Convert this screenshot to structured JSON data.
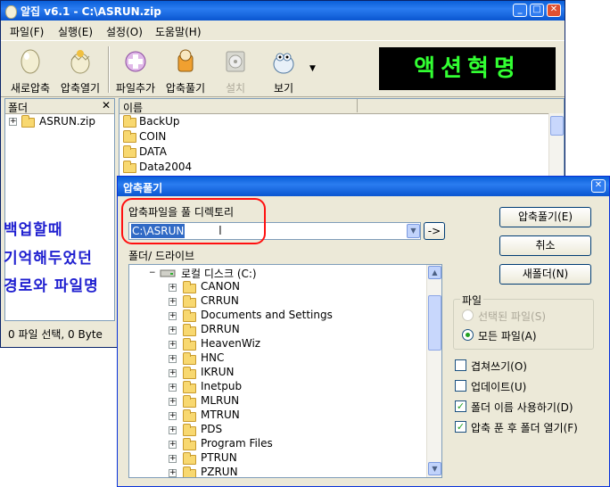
{
  "main_window": {
    "title": "알집 v6.1 - C:\\ASRUN.zip",
    "menus": [
      "파일(F)",
      "실행(E)",
      "설정(O)",
      "도움말(H)"
    ],
    "toolbar": [
      {
        "label": "새로압축",
        "icon": "egg-new-icon",
        "enabled": true
      },
      {
        "label": "압축열기",
        "icon": "egg-open-icon",
        "enabled": true
      },
      {
        "label": "파일추가",
        "icon": "add-file-icon",
        "enabled": true
      },
      {
        "label": "압축풀기",
        "icon": "extract-icon",
        "enabled": true
      },
      {
        "label": "설치",
        "icon": "install-disc-icon",
        "enabled": false
      },
      {
        "label": "보기",
        "icon": "view-icon",
        "enabled": true
      }
    ],
    "banner": "액션혁명",
    "tree_header": "폴더",
    "tree_close": "✕",
    "tree_items": [
      "ASRUN.zip"
    ],
    "list_header": "이름",
    "list_items": [
      "BackUp",
      "COIN",
      "DATA",
      "Data2004"
    ],
    "status": "0 파일 선택,  0 Byte"
  },
  "annotation": [
    "백업할때",
    "기억해두었던",
    "경로와 파일명"
  ],
  "extract_dialog": {
    "title": "압축풀기",
    "close": "✕",
    "path_label": "압축파일을 풀 디렉토리",
    "path_value": "C:\\ASRUN",
    "go_button": "->",
    "folder_drive_label": "폴더/ 드라이브",
    "drive_root": "로컬 디스크 (C:)",
    "folders": [
      "CANON",
      "CRRUN",
      "Documents and Settings",
      "DRRUN",
      "HeavenWiz",
      "HNC",
      "IKRUN",
      "Inetpub",
      "MLRUN",
      "MTRUN",
      "PDS",
      "Program Files",
      "PTRUN",
      "PZRUN"
    ],
    "buttons": {
      "extract": "압축풀기(E)",
      "cancel": "취소",
      "new_folder": "새폴더(N)"
    },
    "file_group": {
      "label": "파일",
      "options": [
        {
          "label": "선택된 파일(S)",
          "checked": false,
          "enabled": false
        },
        {
          "label": "모든 파일(A)",
          "checked": true,
          "enabled": true
        }
      ]
    },
    "checkboxes": [
      {
        "label": "겹쳐쓰기(O)",
        "checked": false
      },
      {
        "label": "업데이트(U)",
        "checked": false
      },
      {
        "label": "폴더 이름 사용하기(D)",
        "checked": true
      },
      {
        "label": "압축 푼 후 폴더 열기(F)",
        "checked": true
      }
    ]
  }
}
